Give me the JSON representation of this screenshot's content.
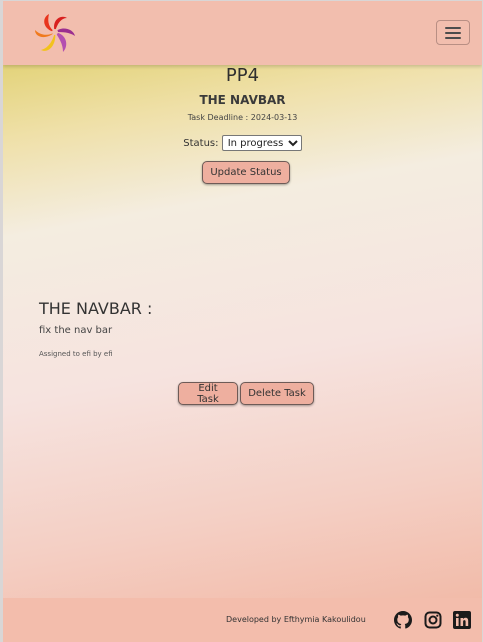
{
  "navbar": {
    "logo_icon": "swirl-logo-icon",
    "menu_icon": "hamburger-menu-icon"
  },
  "task": {
    "title": "PP4",
    "subtitle": "THE NAVBAR",
    "deadline": "Task Deadline : 2024-03-13",
    "status_label": "Status:",
    "status_value": "In progress",
    "update_button": "Update Status"
  },
  "card": {
    "heading": "THE NAVBAR :",
    "description": "fix the nav bar",
    "assigned": "Assigned to efi by efi",
    "edit_button": "Edit Task",
    "delete_button": "Delete Task"
  },
  "footer": {
    "credit": "Developed by Efthymia Kakoulidou",
    "icons": [
      "github-icon",
      "instagram-icon",
      "linkedin-icon"
    ]
  },
  "colors": {
    "navbar_bg": "#f2beae",
    "button_bg": "#eeaf9f",
    "footer_bg": "#f3bdac"
  }
}
